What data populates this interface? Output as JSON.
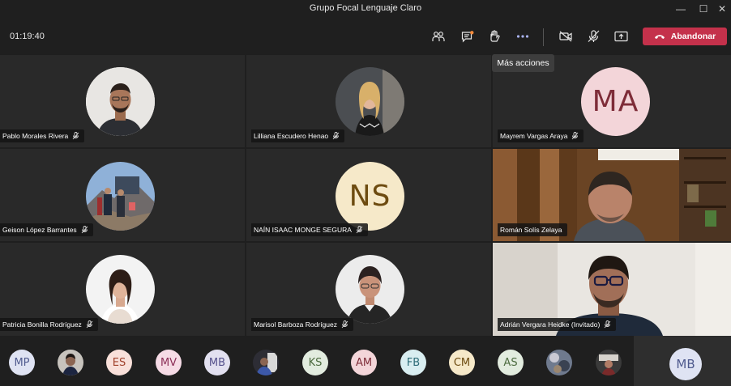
{
  "window": {
    "title": "Grupo Focal Lenguaje Claro",
    "minimize": "—",
    "maximize": "☐",
    "close": "✕"
  },
  "toolbar": {
    "timer": "01:19:40",
    "leave_label": "Abandonar",
    "tooltip": "Más acciones",
    "leave_color": "#c4314b",
    "icons": [
      "participants-icon",
      "chat-icon",
      "raise-hand-icon",
      "more-actions-icon",
      "camera-off-icon",
      "mic-off-icon",
      "share-screen-icon",
      "phone-hangup-icon"
    ]
  },
  "grid": {
    "tiles": [
      {
        "name": "Pablo Morales Rivera",
        "type": "photo"
      },
      {
        "name": "Lilliana Escudero Henao",
        "type": "photo"
      },
      {
        "name": "Mayrem Vargas Araya",
        "type": "initials",
        "initials": "MA",
        "bg": "#f3d5d9",
        "fg": "#7e2c38"
      },
      {
        "name": "Geison López Barrantes",
        "type": "photo"
      },
      {
        "name": "NAÍN ISAAC MONGE SEGURA",
        "type": "initials",
        "initials": "NS",
        "bg": "#f6e9c9",
        "fg": "#6d4b10"
      },
      {
        "name": "Román Solís Zelaya",
        "type": "video"
      },
      {
        "name": "Patricia Bonilla Rodríguez",
        "type": "photo"
      },
      {
        "name": "Marisol Barboza Rodríguez",
        "type": "photo"
      },
      {
        "name": "Adrián Vergara Heidke (Invitado)",
        "type": "video"
      }
    ]
  },
  "strip": {
    "participants": [
      {
        "initials": "MP",
        "bg": "#dfe3f3",
        "fg": "#4f5a8e"
      },
      {
        "initials": "",
        "photo": true
      },
      {
        "initials": "ES",
        "bg": "#f9e0da",
        "fg": "#a1432d"
      },
      {
        "initials": "MV",
        "bg": "#f6dbe6",
        "fg": "#8c2f58"
      },
      {
        "initials": "MB",
        "bg": "#e2e0f0",
        "fg": "#54508c"
      },
      {
        "initials": "",
        "photo": true
      },
      {
        "initials": "KS",
        "bg": "#e2ecdf",
        "fg": "#4c6b3f"
      },
      {
        "initials": "AM",
        "bg": "#f3d5d9",
        "fg": "#7e2c38"
      },
      {
        "initials": "FB",
        "bg": "#d9eef1",
        "fg": "#2d6c78"
      },
      {
        "initials": "CM",
        "bg": "#f6e9c9",
        "fg": "#6d4b10"
      },
      {
        "initials": "AS",
        "bg": "#e2ecdf",
        "fg": "#4c6b3f"
      },
      {
        "initials": "",
        "photo": true
      },
      {
        "initials": "",
        "photo": true
      }
    ],
    "self": {
      "initials": "MB"
    }
  }
}
